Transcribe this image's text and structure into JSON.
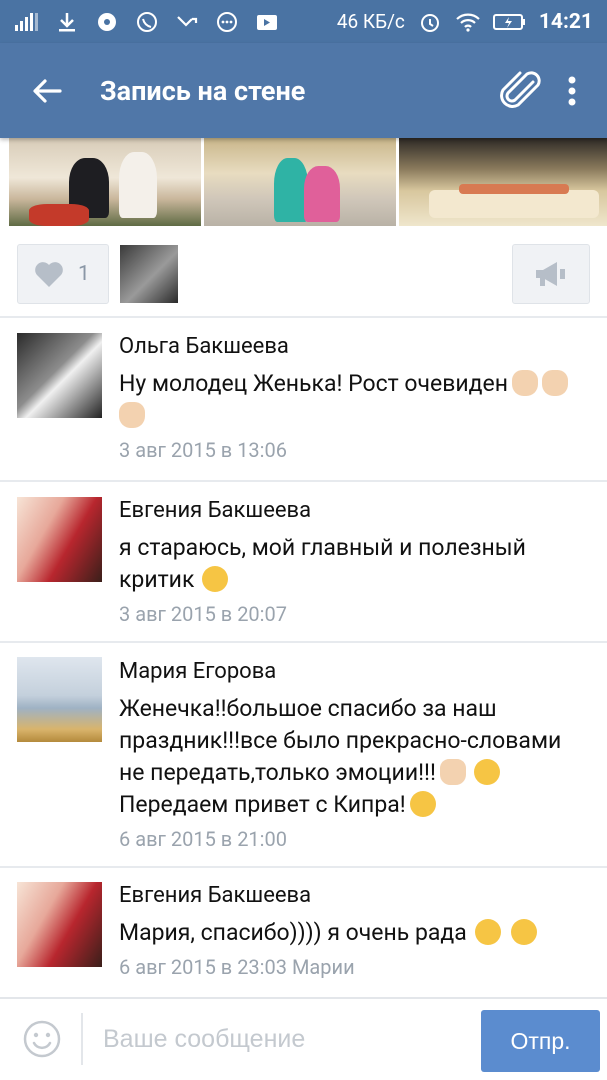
{
  "status_bar": {
    "speed": "46 КБ/с",
    "time": "14:21"
  },
  "toolbar": {
    "title": "Запись на стене",
    "back_icon": "arrow-left-icon",
    "attach_icon": "paperclip-icon",
    "more_icon": "more-vertical-icon"
  },
  "post": {
    "likes_count": "1",
    "like_icon": "heart-icon",
    "share_icon": "megaphone-icon"
  },
  "comments": [
    {
      "author": "Ольга Бакшеева",
      "text": "Ну молодец Женька! Рост очевиден",
      "emojis_after": [
        "clapping-hands",
        "clapping-hands",
        "clapping-hands"
      ],
      "date": "3 авг 2015 в 13:06"
    },
    {
      "author": "Евгения Бакшеева",
      "text": "я стараюсь, мой главный и полезный критик",
      "emojis_after": [
        "winking-face"
      ],
      "date": "3 авг 2015 в 20:07"
    },
    {
      "author": "Мария Егорова",
      "text_line1": "Женечка!!большое спасибо за наш праздник!!!все было прекрасно-словами не передать,только эмоции!!!",
      "emojis_mid": [
        "thumbs-up",
        "face-blowing-kiss"
      ],
      "text_line2": "Передаем привет с Кипра!",
      "emojis_after": [
        "winking-face"
      ],
      "date": "6 авг 2015 в 21:00"
    },
    {
      "author": "Евгения Бакшеева",
      "text": "Мария, спасибо)))) я очень рада",
      "emojis_after": [
        "winking-face-with-tongue",
        "winking-face-with-tongue"
      ],
      "date": "6 авг 2015 в 23:03 Марии"
    }
  ],
  "input_bar": {
    "placeholder": "Ваше сообщение",
    "send_label": "Отпр.",
    "emoji_icon": "smile-icon"
  },
  "colors": {
    "status_bar": "#4a73a3",
    "toolbar": "#5077a8",
    "send_button": "#5b8ccf",
    "date_text": "#9aa3ad"
  }
}
